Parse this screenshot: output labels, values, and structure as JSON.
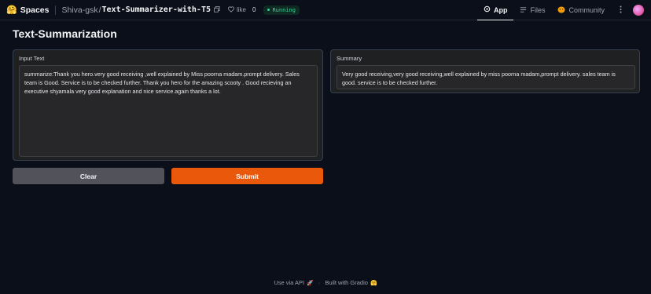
{
  "topbar": {
    "logo_emoji": "🤗",
    "logo_text": "Spaces",
    "owner": "Shiva-gsk",
    "slash": "/",
    "repo": "Text-Summarizer-with-T5",
    "like_label": "like",
    "like_count": "0",
    "status": "Running",
    "nav": {
      "app": "App",
      "files": "Files",
      "community": "Community"
    }
  },
  "main": {
    "title": "Text-Summarization",
    "input_label": "Input Text",
    "input_value": "summarize:Thank you hero.very good receiving ,well explained by Miss poorna madam.prompt delivery. Sales team is Good. Service is to be checked further. Thank you hero for the amazing scooty . Good recieving an executive shyamala very good explanation and nice service.again thanks a lot.",
    "summary_label": "Summary",
    "summary_value": "Very good receiving,very good receiving,well explained by miss poorna madam,prompt delivery. sales team is good. service is to be checked further.",
    "clear_label": "Clear",
    "submit_label": "Submit"
  },
  "footer": {
    "api_label": "Use via API",
    "api_emoji": "🚀",
    "separator": "·",
    "built_label": "Built with Gradio",
    "built_emoji": "🤗"
  },
  "colors": {
    "accent": "#ea580c",
    "running": "#34d399",
    "background": "#0b0f19"
  },
  "icons": [
    "copy-icon",
    "heart-icon",
    "app-icon",
    "files-icon",
    "community-icon",
    "kebab-icon"
  ]
}
